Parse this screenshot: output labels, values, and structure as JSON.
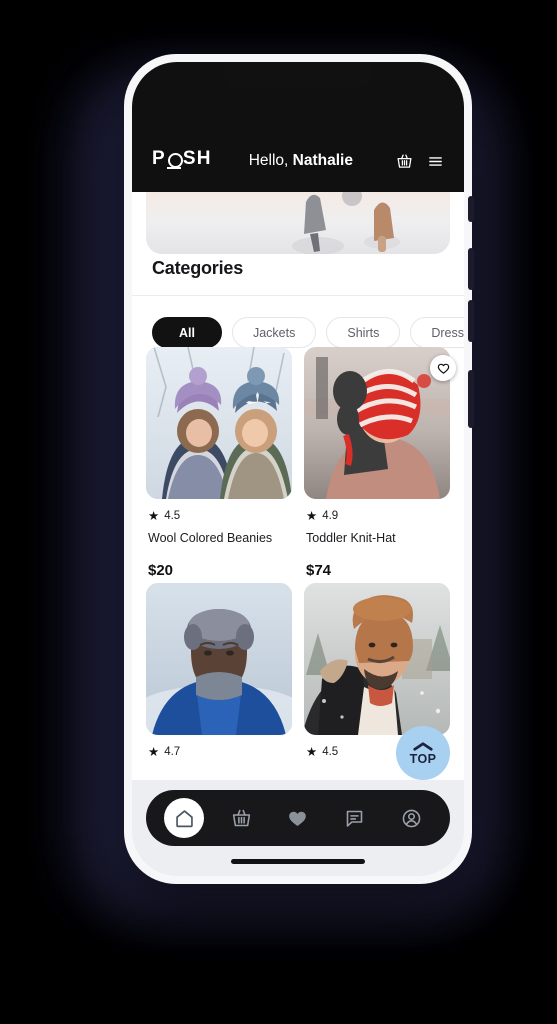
{
  "app": {
    "logo_pre": "P",
    "logo_o": "o-underlined-mark",
    "logo_post": "SH",
    "logo_text": "POSH",
    "greeting_prefix": "Hello, ",
    "greeting_name": "Nathalie"
  },
  "header": {
    "basket_icon": "shopping-basket-icon",
    "menu_icon": "hamburger-menu-icon"
  },
  "categories": {
    "title": "Categories",
    "chips": [
      {
        "label": "All",
        "active": true
      },
      {
        "label": "Jackets",
        "active": false
      },
      {
        "label": "Shirts",
        "active": false
      },
      {
        "label": "Dresses",
        "active": false
      }
    ]
  },
  "products": [
    {
      "name": "Wool Colored Beanies",
      "rating": "4.5",
      "price": "$20",
      "favorite": false,
      "image_alt": "two-women-in-knit-beanies-in-snow"
    },
    {
      "name": "Toddler Knit-Hat",
      "rating": "4.9",
      "price": "$74",
      "favorite": true,
      "image_alt": "toddler-in-red-white-knit-hat"
    },
    {
      "name": "",
      "rating": "4.7",
      "price": "",
      "favorite": false,
      "image_alt": "woman-in-blue-coat-with-fur-hat"
    },
    {
      "name": "",
      "rating": "4.5",
      "price": "",
      "favorite": true,
      "image_alt": "man-in-brown-beanie-and-parka"
    }
  ],
  "scroll_top": {
    "label": "TOP",
    "icon": "chevron-up-icon",
    "color": "#a8d0f0"
  },
  "bottom_nav": [
    {
      "icon": "home-icon",
      "active": true
    },
    {
      "icon": "basket-icon",
      "active": false
    },
    {
      "icon": "heart-icon",
      "active": false
    },
    {
      "icon": "chat-icon",
      "active": false
    },
    {
      "icon": "profile-icon",
      "active": false
    }
  ],
  "star_glyph": "★",
  "colors": {
    "header_bg": "#101010",
    "accent_chip_active": "#121212",
    "nav_bg": "#18181b",
    "top_btn": "#a8d0f0",
    "bottom_area": "#eceef2"
  }
}
